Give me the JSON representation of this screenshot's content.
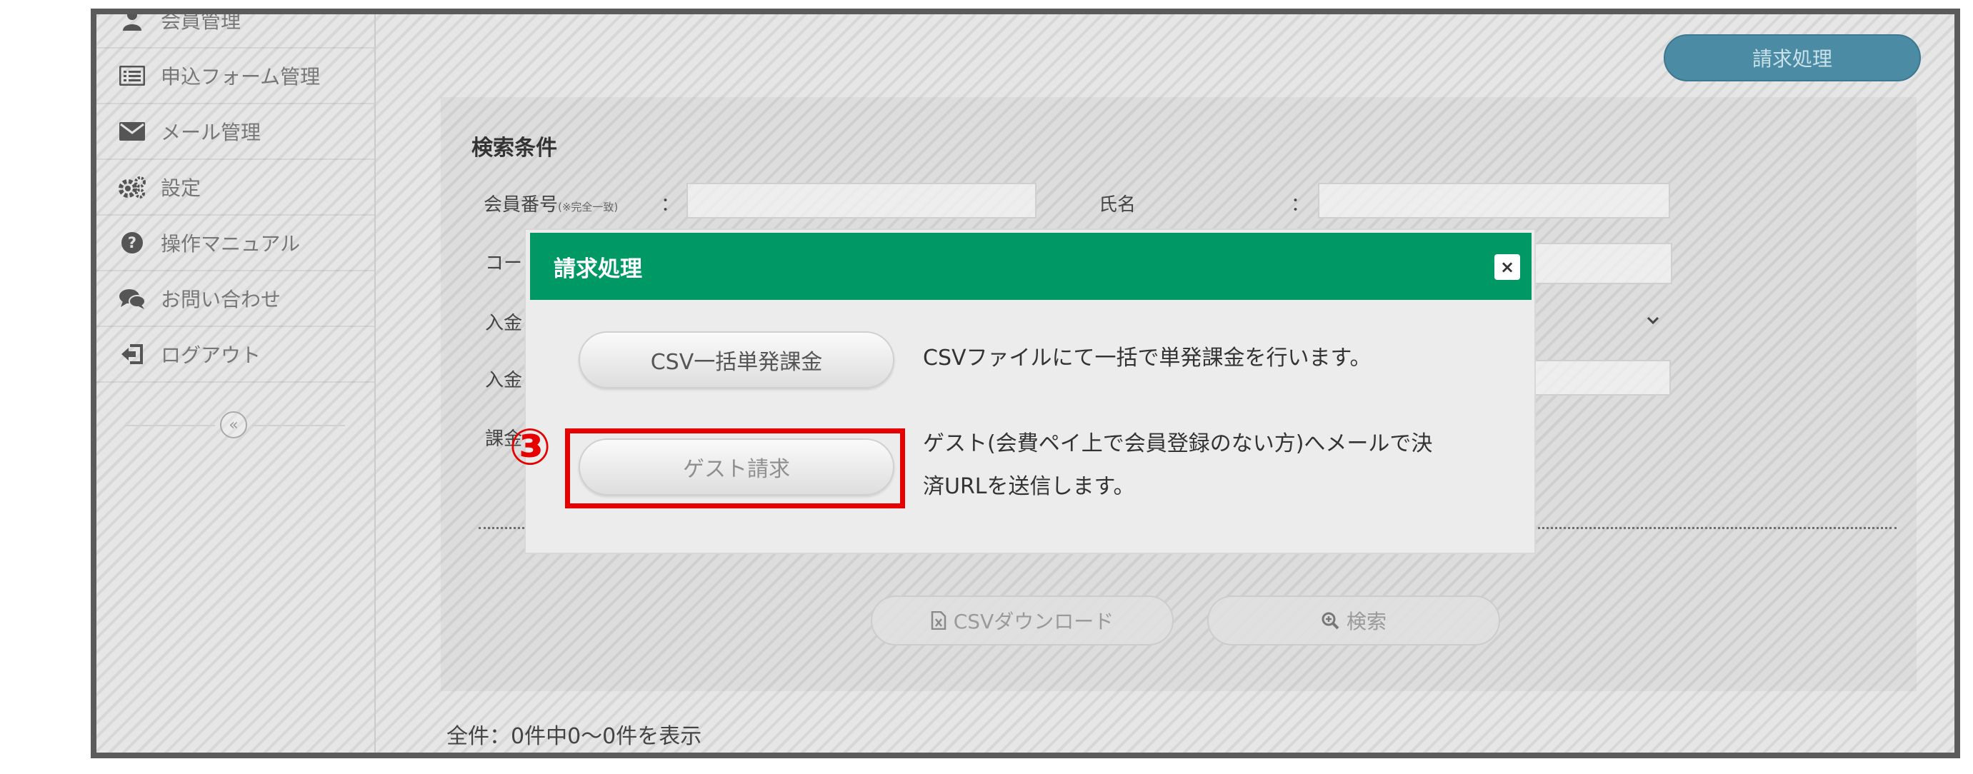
{
  "sidebar": {
    "items": [
      {
        "label": "会員管理",
        "icon": "user-icon"
      },
      {
        "label": "申込フォーム管理",
        "icon": "form-list-icon"
      },
      {
        "label": "メール管理",
        "icon": "envelope-icon"
      },
      {
        "label": "設定",
        "icon": "gears-icon"
      },
      {
        "label": "操作マニュアル",
        "icon": "question-circle-icon"
      },
      {
        "label": "お問い合わせ",
        "icon": "chat-bubbles-icon"
      },
      {
        "label": "ログアウト",
        "icon": "sign-out-icon"
      }
    ],
    "collapse_symbol": "«"
  },
  "header": {
    "billing_button": "請求処理"
  },
  "search": {
    "title": "検索条件",
    "member_number_label": "会員番号",
    "member_number_note": "(※完全一致)",
    "name_label": "氏名",
    "colon": "：",
    "row2_label_partial": "コー",
    "row3_label_partial": "入金",
    "row4_label_partial": "入金",
    "row5_label_partial": "課金"
  },
  "actions": {
    "csv_download": "CSVダウンロード",
    "search": "検索"
  },
  "results": {
    "count_text": "全件：0件中0〜0件を表示"
  },
  "modal": {
    "title": "請求処理",
    "close_symbol": "×",
    "csv_button": "CSV一括単発課金",
    "csv_description": "CSVファイルにて一括で単発課金を行います。",
    "guest_button": "ゲスト請求",
    "guest_description_line1": "ゲスト(会費ペイ上で会員登録のない方)へメールで決",
    "guest_description_line2": "済URLを送信します。"
  },
  "annotation": {
    "step_number": "③",
    "highlight_color": "#e60000"
  },
  "colors": {
    "modal_header": "#009966",
    "billing_button": "#4b8ba3"
  }
}
